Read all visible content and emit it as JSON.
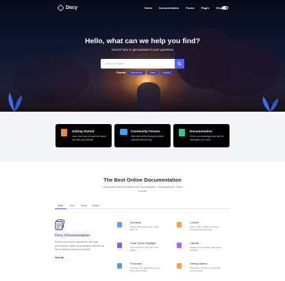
{
  "nav": {
    "logo": "Docy",
    "menu": [
      "Home",
      "Documentation",
      "Forum",
      "Pages",
      "Shop"
    ]
  },
  "hero": {
    "title": "Hello, what can we help you find?",
    "subtitle": "Search here to get answers to your questions",
    "search_placeholder": "Search for topics...",
    "popular_label": "Popular:",
    "tags": [
      "Membership",
      "Guide",
      "Feature"
    ]
  },
  "cards": [
    {
      "title": "Getting Started",
      "desc": "Learn here how to install the theme and start your website.",
      "icon": "document-icon",
      "color": "#f08a36"
    },
    {
      "title": "Community Forums",
      "desc": "View here all the frequently asked questions about Docy.",
      "icon": "chat-icon",
      "color": "#38a8f0"
    },
    {
      "title": "Documentation",
      "desc": "Check our knowledge base with all information you need.",
      "icon": "book-icon",
      "color": "#2ec4a0"
    }
  ],
  "docs": {
    "title": "The Best Online Documentation",
    "subtitle": "Loaded with awesome features like Documentation, Knowledgebase, Forum & more!",
    "tabs": [
      "Docy",
      "Hello",
      "Ninjas",
      "Sample"
    ],
    "feature": {
      "title": "Docy Documentation",
      "desc": "Docy is a powerful, responsive, and high-performance online documentation WordPress theme that can assist you quickly.",
      "view_all": "View All"
    },
    "items": [
      {
        "title": "Elements",
        "desc": "James Bond transmit pip of that show off",
        "icon": "elements-icon",
        "color": "#5b9cf5"
      },
      {
        "title": "Content",
        "desc": "Video, Table, Tooltips, List items, Keyboard Shortcuts and",
        "icon": "content-icon",
        "color": "#f5a04a"
      },
      {
        "title": "Code Syntax Highlight",
        "desc": "We used Prism.JS on the Code widget.",
        "icon": "code-icon",
        "color": "#8a5cf5"
      },
      {
        "title": "Layouts",
        "desc": "Display documentation page layout variations",
        "icon": "layouts-icon",
        "color": "#b06ad8"
      },
      {
        "title": "Footnotes",
        "desc": "Footnote is an additional piece of information printed",
        "icon": "footnotes-icon",
        "color": "#4a9cf0"
      },
      {
        "title": "Getting Started",
        "desc": "Welcome to docbuzz! Get familiar with the Setup",
        "icon": "start-icon",
        "color": "#f5a04a"
      }
    ]
  }
}
